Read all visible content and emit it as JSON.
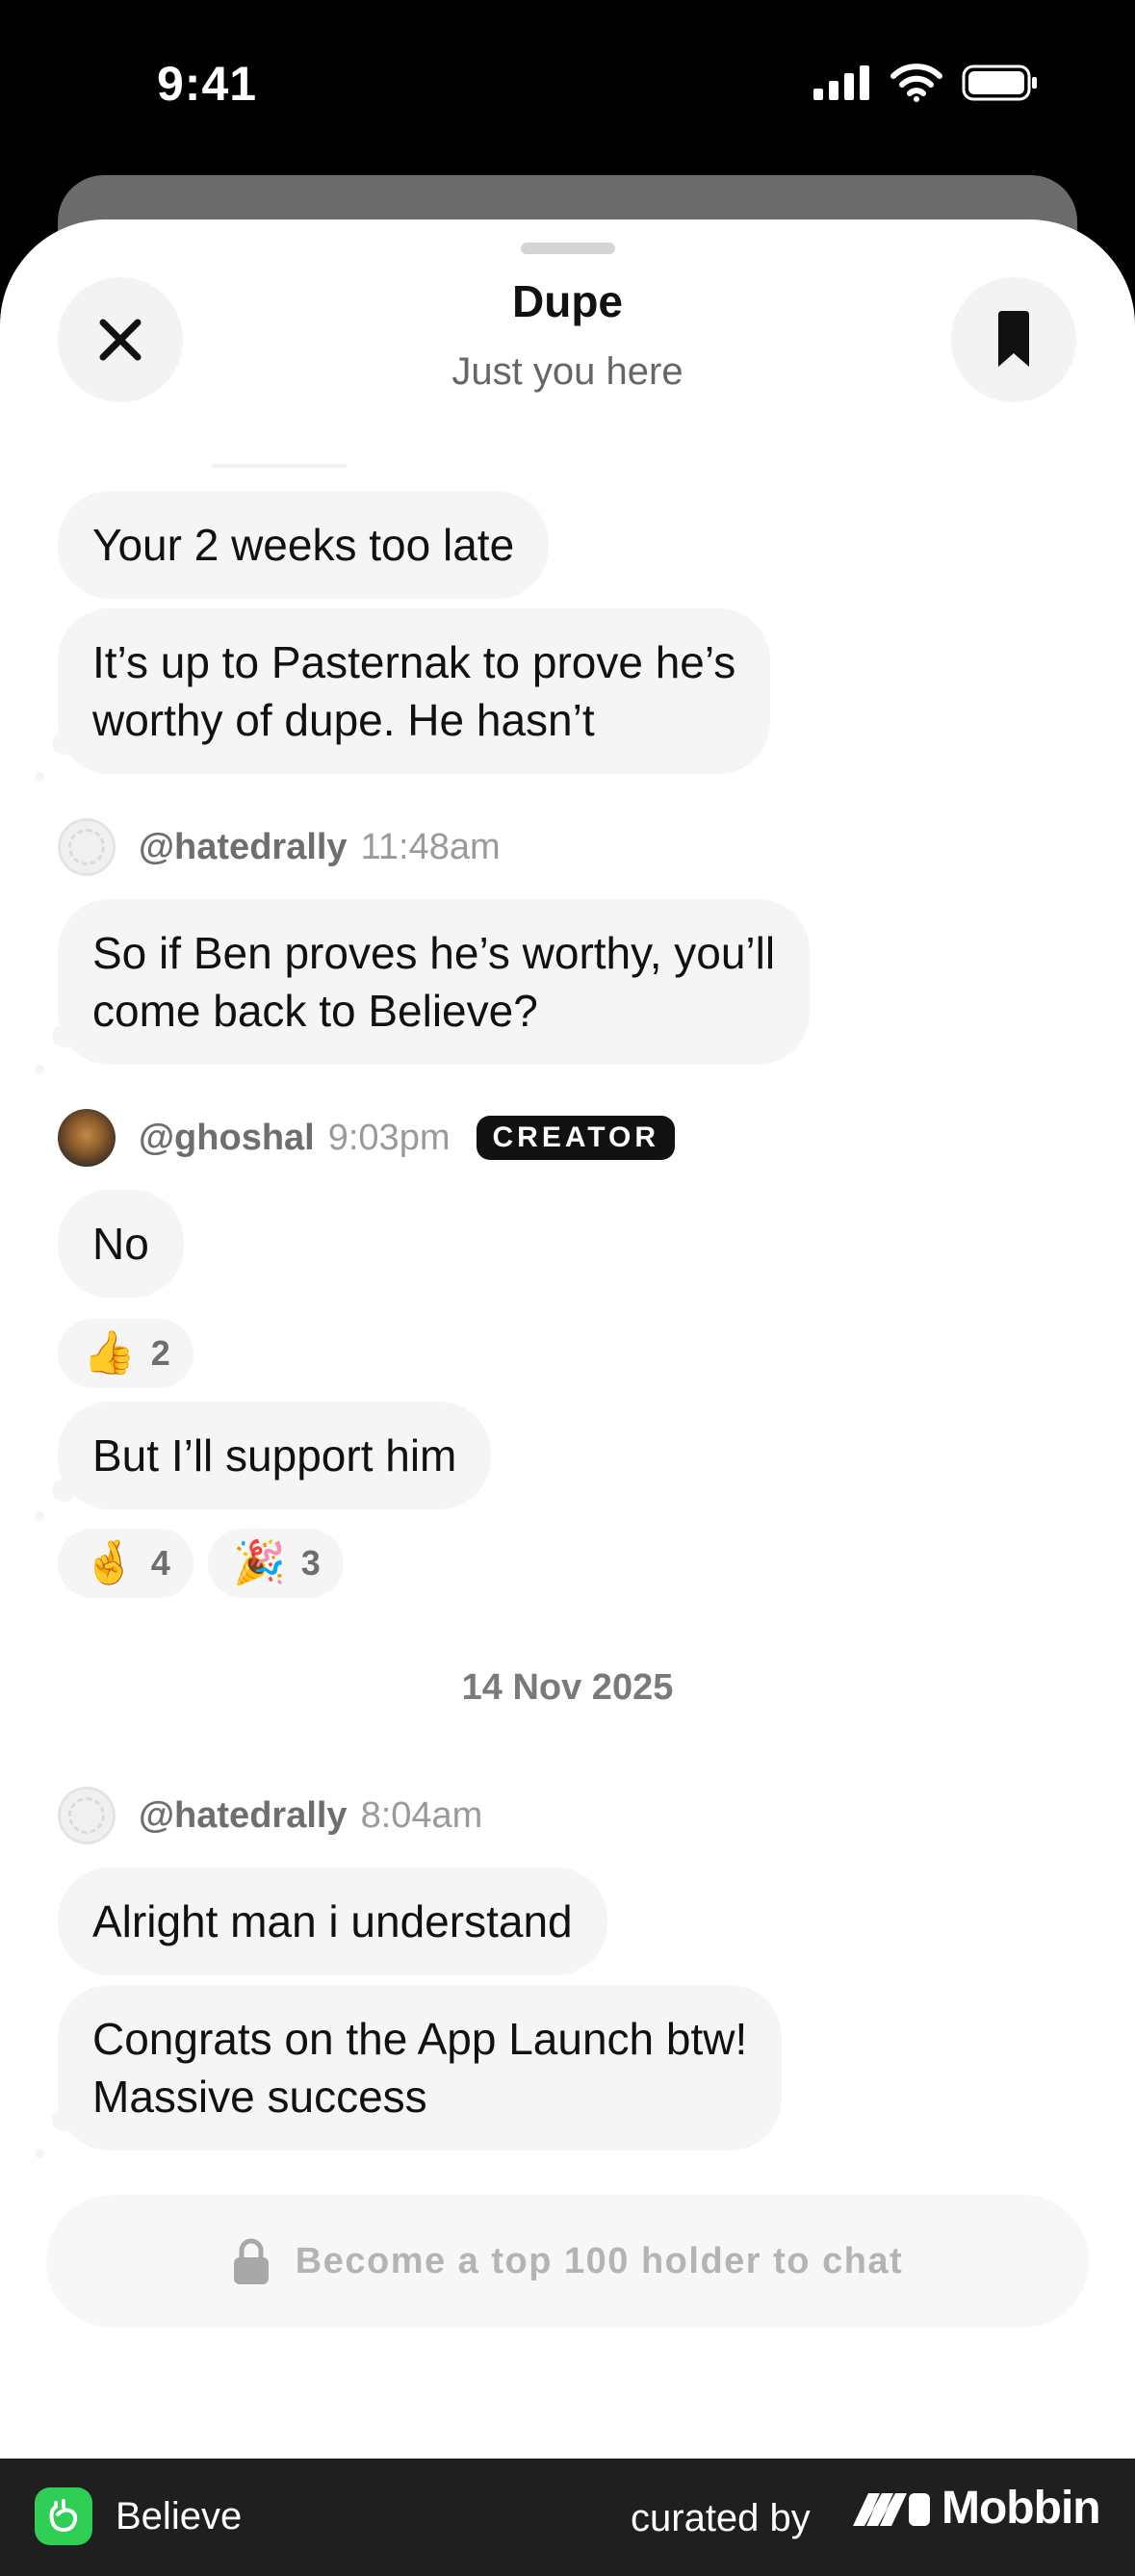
{
  "status_bar": {
    "time": "9:41"
  },
  "header": {
    "title": "Dupe",
    "subtitle": "Just you here"
  },
  "messages": {
    "m1": "Your 2 weeks too late",
    "m2": "It’s up to Pasternak to prove he’s\nworthy of dupe. He hasn’t",
    "m3": "So if Ben proves he’s worthy, you’ll\ncome back to Believe?",
    "m4": "No",
    "m5": "But I’ll support him",
    "m6": "Alright man i understand",
    "m7": "Congrats on the App Launch btw!\nMassive success"
  },
  "senders": {
    "hatedrally_1": {
      "username": "@hatedrally",
      "time": "11:48am"
    },
    "ghoshal": {
      "username": "@ghoshal",
      "time": "9:03pm",
      "badge": "CREATOR"
    },
    "hatedrally_2": {
      "username": "@hatedrally",
      "time": "8:04am"
    }
  },
  "reactions": {
    "r1": {
      "emoji": "👍",
      "count": "2"
    },
    "r2": {
      "emoji": "🤞",
      "count": "4"
    },
    "r3": {
      "emoji": "🎉",
      "count": "3"
    }
  },
  "date_separator": "14 Nov 2025",
  "composer": {
    "locked_text": "Become a top 100 holder to chat",
    "icon": "lock-icon"
  },
  "footer": {
    "app_name": "Believe",
    "curated_by": "curated by",
    "brand": "Mobbin"
  },
  "colors": {
    "app_green": "#2fcf55",
    "bubble_bg": "#f5f5f5",
    "badge_bg": "#111111"
  }
}
